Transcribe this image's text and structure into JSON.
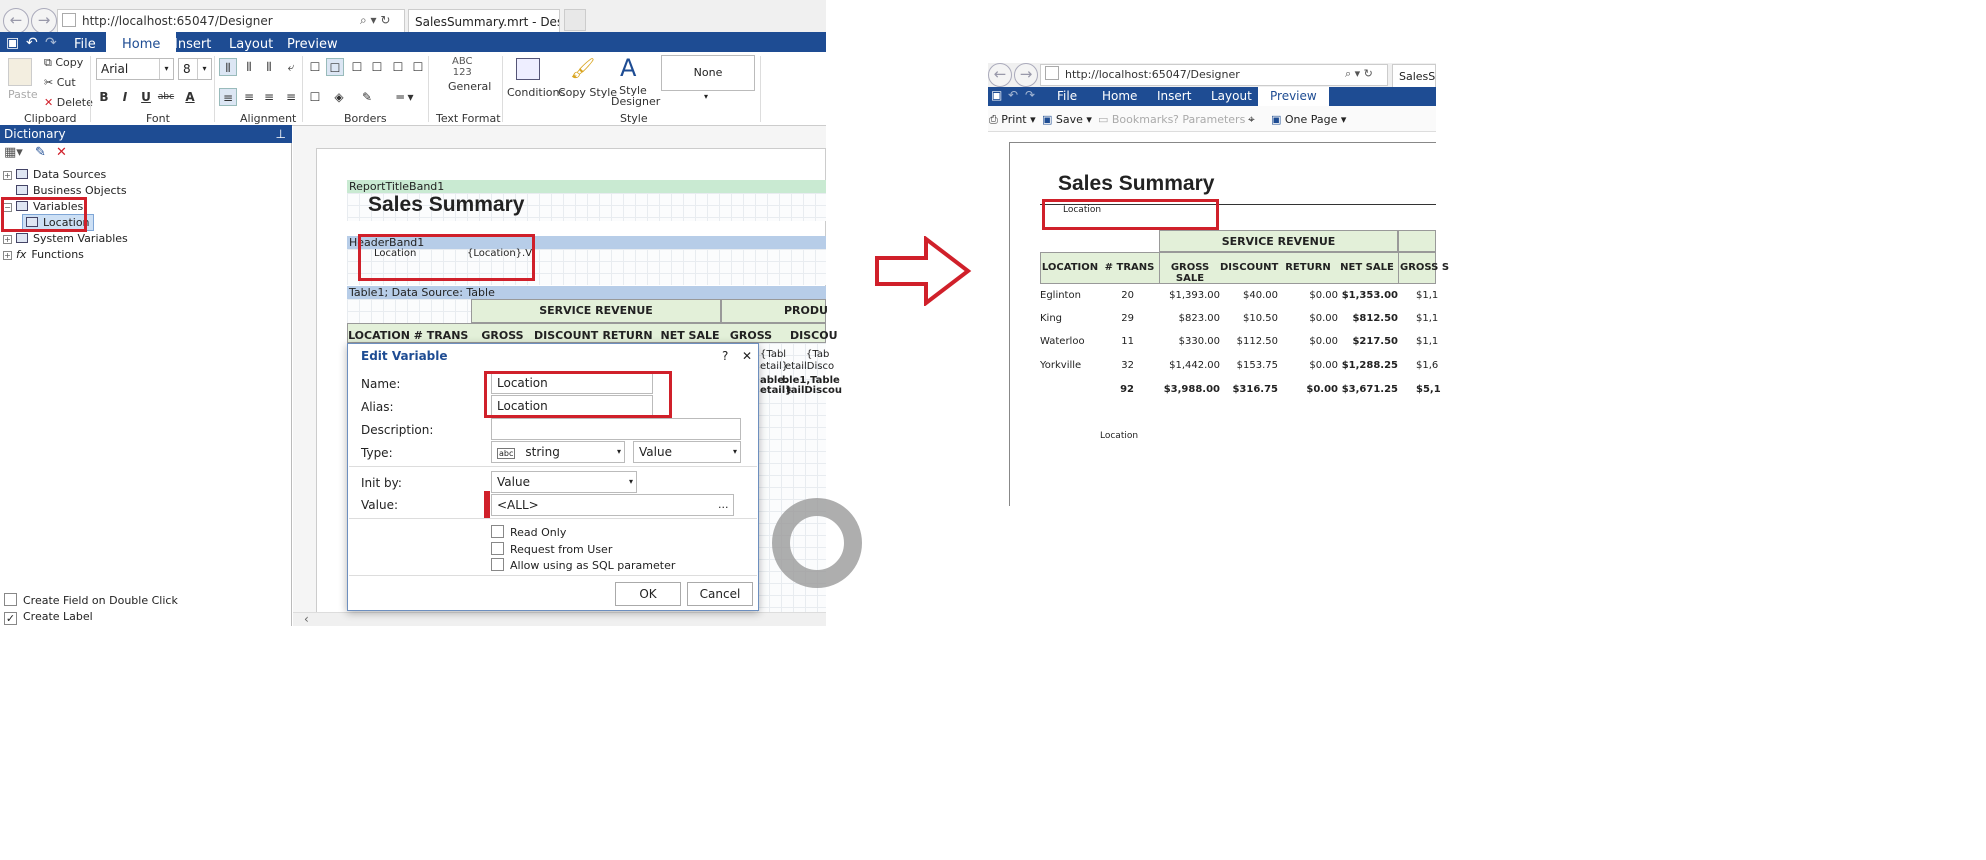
{
  "designer": {
    "browser": {
      "url": "http://localhost:65047/Designer",
      "tab_title": "SalesSummary.mrt - Design..."
    },
    "menu": {
      "file": "File",
      "home": "Home",
      "insert": "Insert",
      "layout": "Layout",
      "preview": "Preview"
    },
    "ribbon": {
      "paste": "Paste",
      "copy": "Copy",
      "cut": "Cut",
      "delete": "Delete",
      "font_name": "Arial",
      "font_size": "8",
      "bold": "B",
      "italic": "I",
      "underline": "U",
      "strike": "abc",
      "general_top": "ABC\n123",
      "general": "General",
      "conditions": "Conditions",
      "copy_style": "Copy Style",
      "style_designer": "Style Designer",
      "style_none": "None",
      "groups": {
        "clipboard": "Clipboard",
        "font": "Font",
        "alignment": "Alignment",
        "borders": "Borders",
        "text_format": "Text Format",
        "style": "Style"
      }
    },
    "dictionary": {
      "title": "Dictionary",
      "tree": [
        "Data Sources",
        "Business Objects",
        "Variables",
        "Location",
        "System Variables",
        "Functions"
      ],
      "create_field": "Create Field on Double Click",
      "create_label": "Create Label"
    },
    "page": {
      "report_title_band": "ReportTitleBand1",
      "report_title": "Sales Summary",
      "header_band": "HeaderBand1",
      "header_label": "Location",
      "header_expr": "{Location}.V",
      "table_band": "Table1; Data Source: Table",
      "service_revenue": "SERVICE REVENUE",
      "product": "PRODU",
      "cols": [
        "LOCATION",
        "# TRANS",
        "GROSS SALE",
        "DISCOUNT",
        "RETURN",
        "NET SALE",
        "GROSS SALE",
        "DISCOU"
      ],
      "cells_r1": [
        "{Tabl",
        "etail}",
        "{Tab",
        "etailDisco"
      ],
      "cells_r2": [
        "able.",
        "etail}",
        "ble1,Table",
        "tailDiscou"
      ]
    },
    "dialog": {
      "title": "Edit Variable",
      "help": "?",
      "close": "✕",
      "name_label": "Name:",
      "name_value": "Location",
      "alias_label": "Alias:",
      "alias_value": "Location",
      "description_label": "Description:",
      "description_value": "",
      "type_label": "Type:",
      "type_value": "string",
      "type_kind": "Value",
      "init_label": "Init by:",
      "init_value": "Value",
      "value_label": "Value:",
      "value_value": "<ALL>",
      "read_only": "Read Only",
      "request_from_user": "Request from User",
      "allow_sql": "Allow using as SQL parameter",
      "ok": "OK",
      "cancel": "Cancel"
    }
  },
  "viewer": {
    "browser": {
      "url": "http://localhost:65047/Designer",
      "tab_title": "SalesS"
    },
    "menu": {
      "file": "File",
      "home": "Home",
      "insert": "Insert",
      "layout": "Layout",
      "preview": "Preview"
    },
    "toolbar": {
      "print": "Print",
      "save": "Save",
      "bookmarks": "Bookmarks",
      "parameters": "Parameters",
      "one_page": "One Page"
    },
    "report": {
      "title": "Sales Summary",
      "location_label": "Location",
      "service_revenue": "SERVICE REVENUE",
      "cols": [
        "LOCATION",
        "# TRANS",
        "GROSS SALE",
        "DISCOUNT",
        "RETURN",
        "NET SALE",
        "GROSS S"
      ],
      "rows": [
        [
          "Eglinton",
          "20",
          "$1,393.00",
          "$40.00",
          "$0.00",
          "$1,353.00",
          "$1,1"
        ],
        [
          "King",
          "29",
          "$823.00",
          "$10.50",
          "$0.00",
          "$812.50",
          "$1,1"
        ],
        [
          "Waterloo",
          "11",
          "$330.00",
          "$112.50",
          "$0.00",
          "$217.50",
          "$1,1"
        ],
        [
          "Yorkville",
          "32",
          "$1,442.00",
          "$153.75",
          "$0.00",
          "$1,288.25",
          "$1,6"
        ]
      ],
      "total": [
        "",
        "92",
        "$3,988.00",
        "$316.75",
        "$0.00",
        "$3,671.25",
        "$5,1"
      ],
      "footer_label": "Location"
    }
  },
  "colors": {
    "ribbon_blue": "#1e4c93",
    "highlight_red": "#d0202a",
    "band_green": "#c9ead2",
    "band_blue": "#b7cde8",
    "header_green": "#e3f0d9"
  }
}
